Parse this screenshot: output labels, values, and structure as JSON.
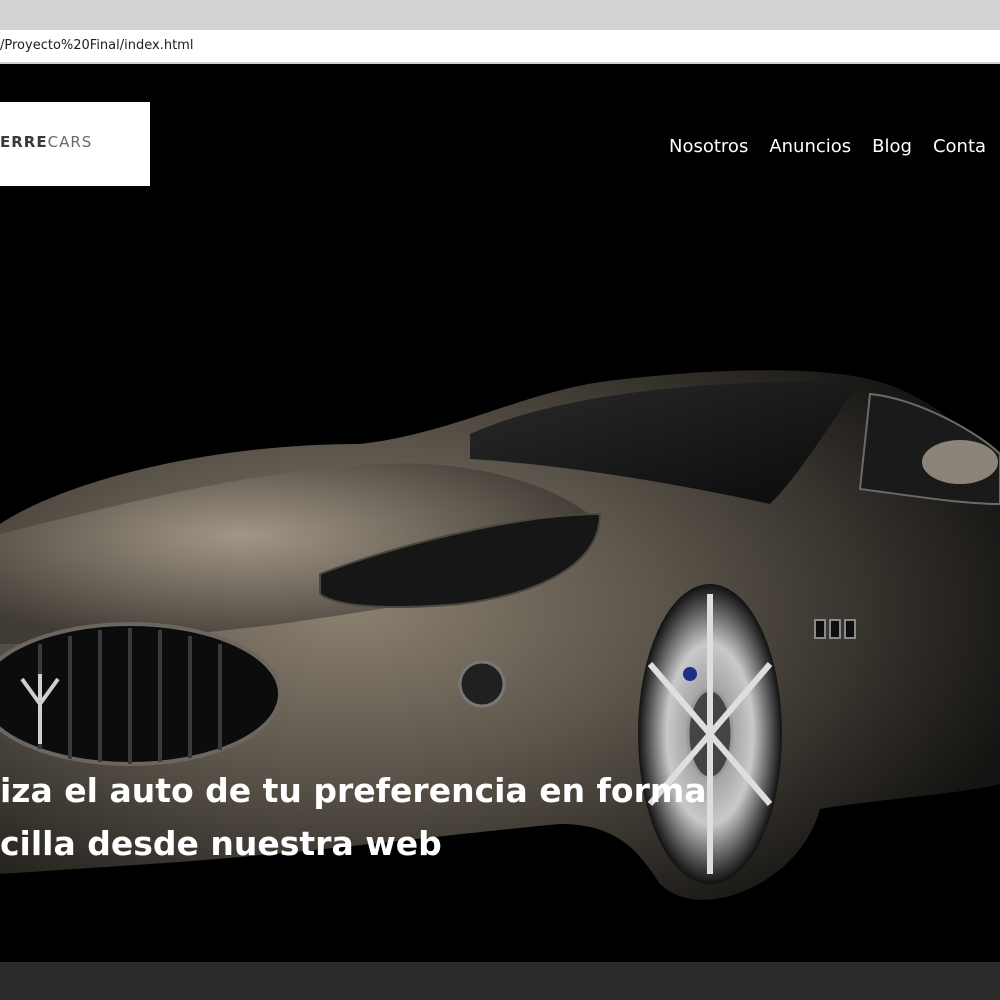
{
  "browser": {
    "url": "/Proyecto%20Final/index.html"
  },
  "site": {
    "logo": {
      "strong": "ERRE",
      "light": "CARS"
    },
    "nav": [
      "Nosotros",
      "Anuncios",
      "Blog",
      "Conta"
    ]
  },
  "hero": {
    "headline_line1": "iza el auto de tu preferencia en forma",
    "headline_line2": "cilla desde nuestra web",
    "image": "sports-car-photo"
  },
  "colors": {
    "background": "#000000",
    "nav_text": "#ffffff",
    "footer_strip": "#2a2a2a"
  }
}
